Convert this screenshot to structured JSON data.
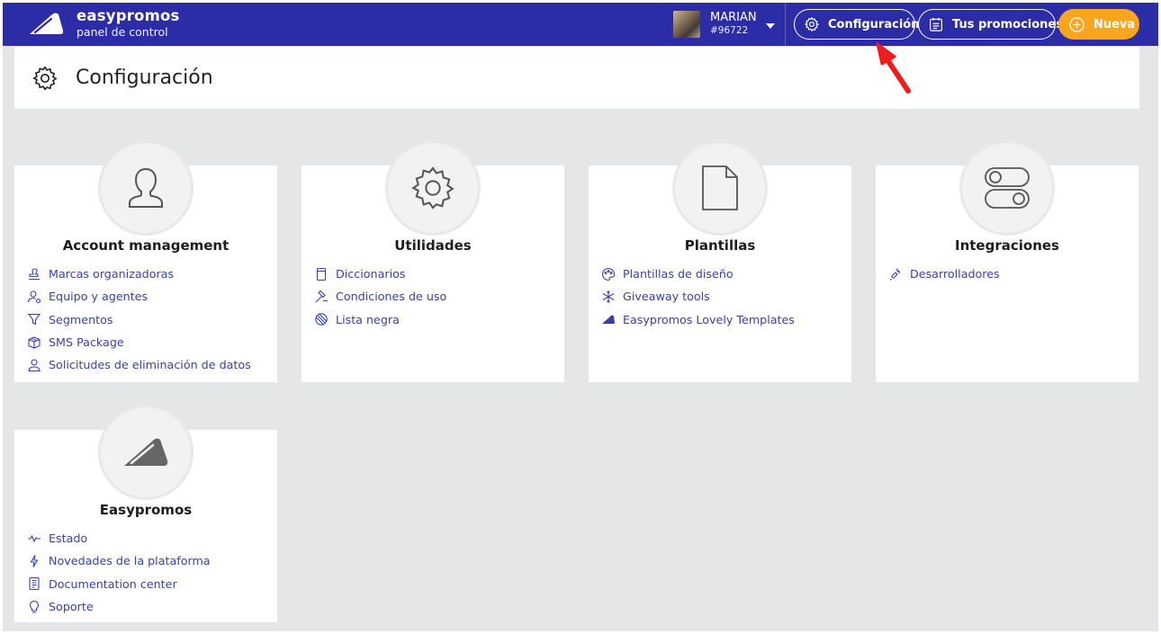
{
  "topbar": {
    "brand_name": "easypromos",
    "brand_sub": "panel de control",
    "user_name": "MARIAN",
    "user_id": "#96722",
    "config_label": "Configuración",
    "promos_label": "Tus promociones",
    "new_label": "Nueva",
    "colors": {
      "bar": "#2b2ca6",
      "accent": "#f8a51f"
    }
  },
  "page": {
    "title": "Configuración"
  },
  "cards": [
    {
      "title": "Account management",
      "icon": "user-icon",
      "links": [
        {
          "label": "Marcas organizadoras",
          "icon": "stamp-icon"
        },
        {
          "label": "Equipo y agentes",
          "icon": "user-settings-icon"
        },
        {
          "label": "Segmentos",
          "icon": "filter-icon"
        },
        {
          "label": "SMS Package",
          "icon": "package-icon"
        },
        {
          "label": "Solicitudes de eliminación de datos",
          "icon": "user-remove-icon"
        }
      ]
    },
    {
      "title": "Utilidades",
      "icon": "gear-icon",
      "links": [
        {
          "label": "Diccionarios",
          "icon": "book-icon"
        },
        {
          "label": "Condiciones de uso",
          "icon": "gavel-icon"
        },
        {
          "label": "Lista negra",
          "icon": "blocked-icon"
        }
      ]
    },
    {
      "title": "Plantillas",
      "icon": "document-icon",
      "links": [
        {
          "label": "Plantillas de diseño",
          "icon": "palette-icon"
        },
        {
          "label": "Giveaway tools",
          "icon": "snowflake-icon"
        },
        {
          "label": "Easypromos Lovely Templates",
          "icon": "easypromos-logo-icon"
        }
      ]
    },
    {
      "title": "Integraciones",
      "icon": "toggles-icon",
      "links": [
        {
          "label": "Desarrolladores",
          "icon": "plug-icon"
        }
      ]
    },
    {
      "title": "Easypromos",
      "icon": "easypromos-logo-icon",
      "links": [
        {
          "label": "Estado",
          "icon": "heartbeat-icon"
        },
        {
          "label": "Novedades de la plataforma",
          "icon": "bolt-icon"
        },
        {
          "label": "Documentation center",
          "icon": "notebook-icon"
        },
        {
          "label": "Soporte",
          "icon": "lightbulb-icon"
        }
      ]
    }
  ]
}
